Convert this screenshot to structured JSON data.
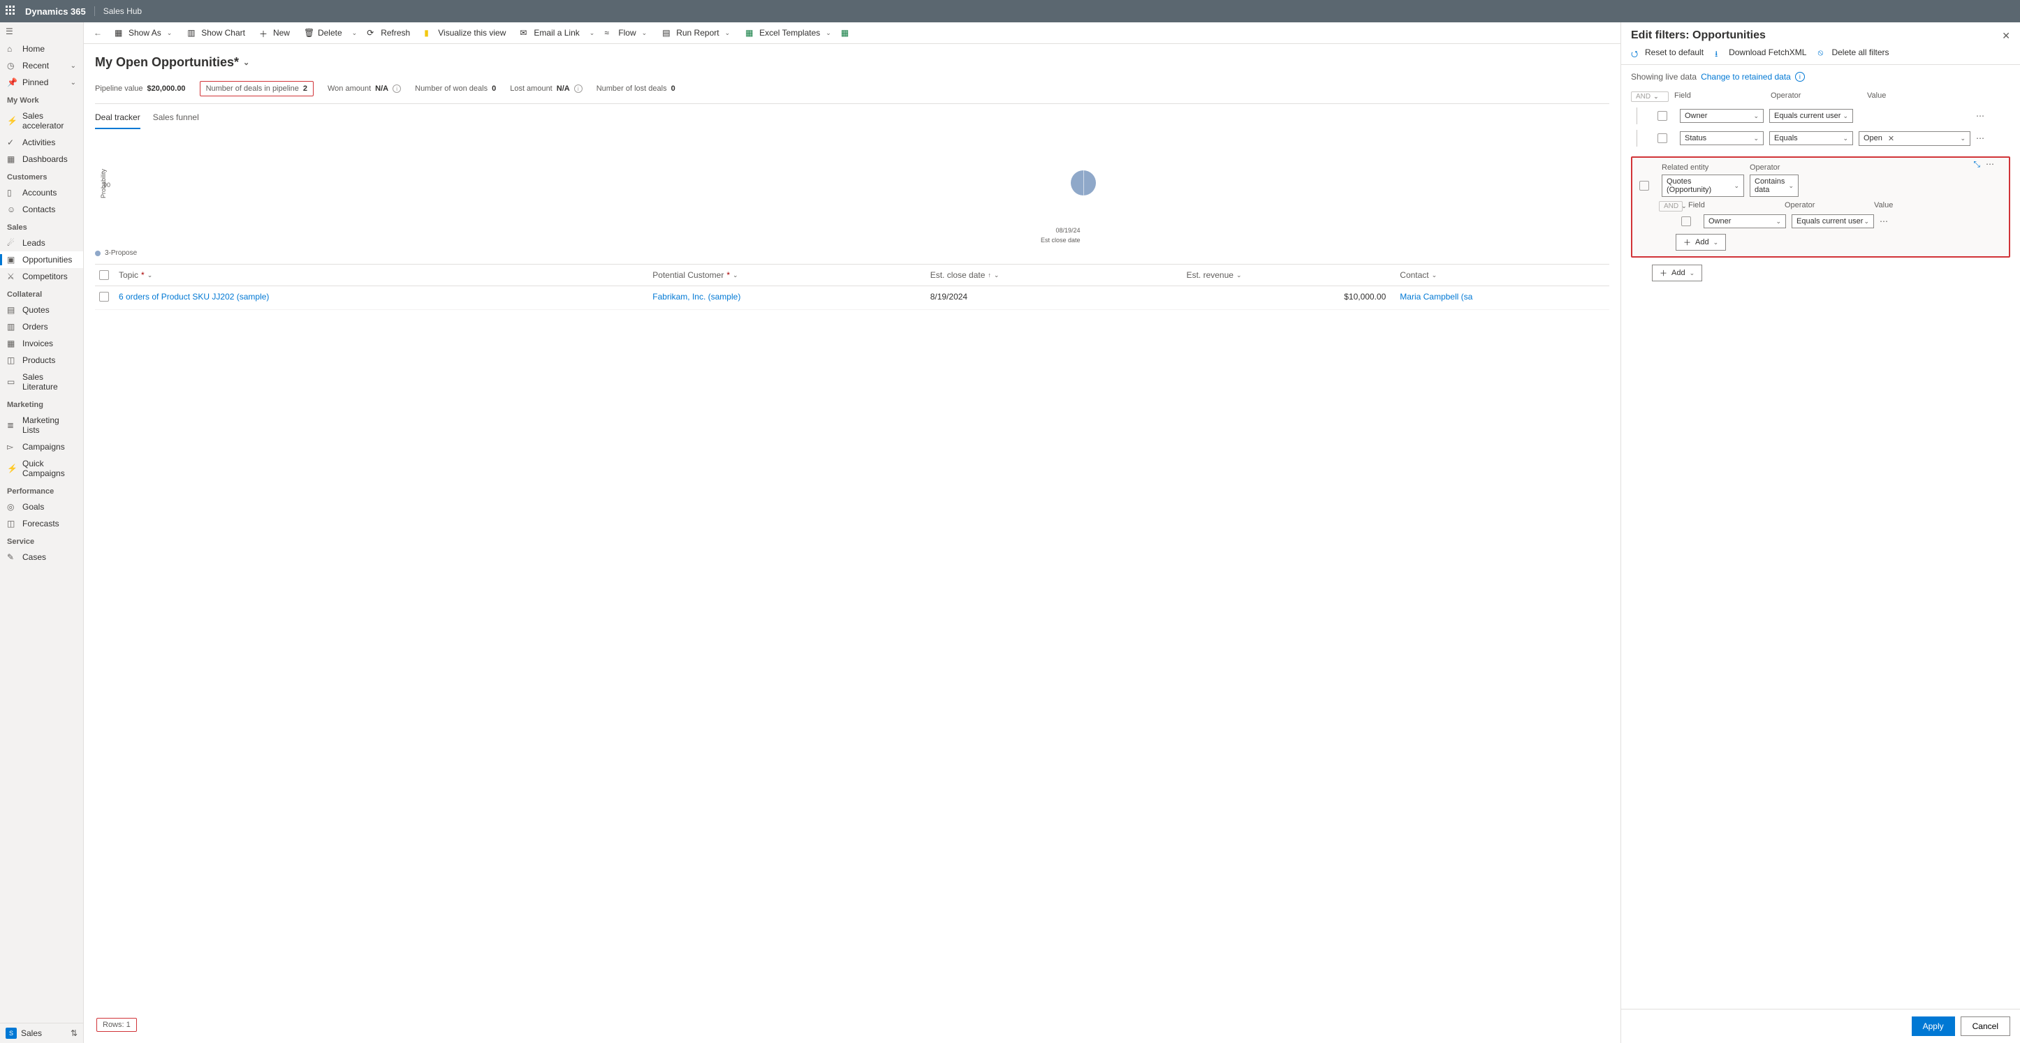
{
  "header": {
    "app": "Dynamics 365",
    "hub": "Sales Hub"
  },
  "sidebar": {
    "home": "Home",
    "recent": "Recent",
    "pinned": "Pinned",
    "mywork": "My Work",
    "mywork_items": [
      "Sales accelerator",
      "Activities",
      "Dashboards"
    ],
    "customers": "Customers",
    "customers_items": [
      "Accounts",
      "Contacts"
    ],
    "sales": "Sales",
    "sales_items": [
      "Leads",
      "Opportunities",
      "Competitors"
    ],
    "collateral": "Collateral",
    "collateral_items": [
      "Quotes",
      "Orders",
      "Invoices",
      "Products",
      "Sales Literature"
    ],
    "marketing": "Marketing",
    "marketing_items": [
      "Marketing Lists",
      "Campaigns",
      "Quick Campaigns"
    ],
    "performance": "Performance",
    "performance_items": [
      "Goals",
      "Forecasts"
    ],
    "service": "Service",
    "service_items": [
      "Cases"
    ],
    "footer": "Sales"
  },
  "cmd": {
    "showas": "Show As",
    "showchart": "Show Chart",
    "new": "New",
    "delete": "Delete",
    "refresh": "Refresh",
    "visualize": "Visualize this view",
    "email": "Email a Link",
    "flow": "Flow",
    "runreport": "Run Report",
    "excel": "Excel Templates"
  },
  "view": {
    "title": "My Open Opportunities*"
  },
  "stats": {
    "pv_l": "Pipeline value",
    "pv_v": "$20,000.00",
    "nd_l": "Number of deals in pipeline",
    "nd_v": "2",
    "wa_l": "Won amount",
    "wa_v": "N/A",
    "nw_l": "Number of won deals",
    "nw_v": "0",
    "la_l": "Lost amount",
    "la_v": "N/A",
    "nl_l": "Number of lost deals",
    "nl_v": "0"
  },
  "tabs": {
    "t1": "Deal tracker",
    "t2": "Sales funnel"
  },
  "chart": {
    "ylabel": "Probability",
    "ytick": "90",
    "xtick": "08/19/24",
    "xlabel": "Est close date",
    "legend": "3-Propose"
  },
  "chart_data": {
    "type": "scatter",
    "title": "My Open Opportunities",
    "xlabel": "Est close date",
    "ylabel": "Probability",
    "series": [
      {
        "name": "3-Propose",
        "points": [
          {
            "x": "08/19/24",
            "y": 90
          }
        ]
      }
    ],
    "ylim": [
      0,
      100
    ]
  },
  "table": {
    "h_topic": "Topic",
    "h_cust": "Potential Customer",
    "h_date": "Est. close date",
    "h_rev": "Est. revenue",
    "h_contact": "Contact",
    "r_topic": "6 orders of Product SKU JJ202 (sample)",
    "r_cust": "Fabrikam, Inc. (sample)",
    "r_date": "8/19/2024",
    "r_rev": "$10,000.00",
    "r_contact": "Maria Campbell (sa"
  },
  "rows": {
    "label": "Rows: 1"
  },
  "panel": {
    "title": "Edit filters: Opportunities",
    "reset": "Reset to default",
    "fetch": "Download FetchXML",
    "delall": "Delete all filters",
    "live": "Showing live data",
    "change": "Change to retained data",
    "and": "AND",
    "field": "Field",
    "operator": "Operator",
    "value": "Value",
    "owner": "Owner",
    "eqcur": "Equals current user",
    "status": "Status",
    "equals": "Equals",
    "open": "Open",
    "related": "Related entity",
    "quotes": "Quotes (Opportunity)",
    "contains": "Contains data",
    "add": "Add",
    "apply": "Apply",
    "cancel": "Cancel"
  }
}
